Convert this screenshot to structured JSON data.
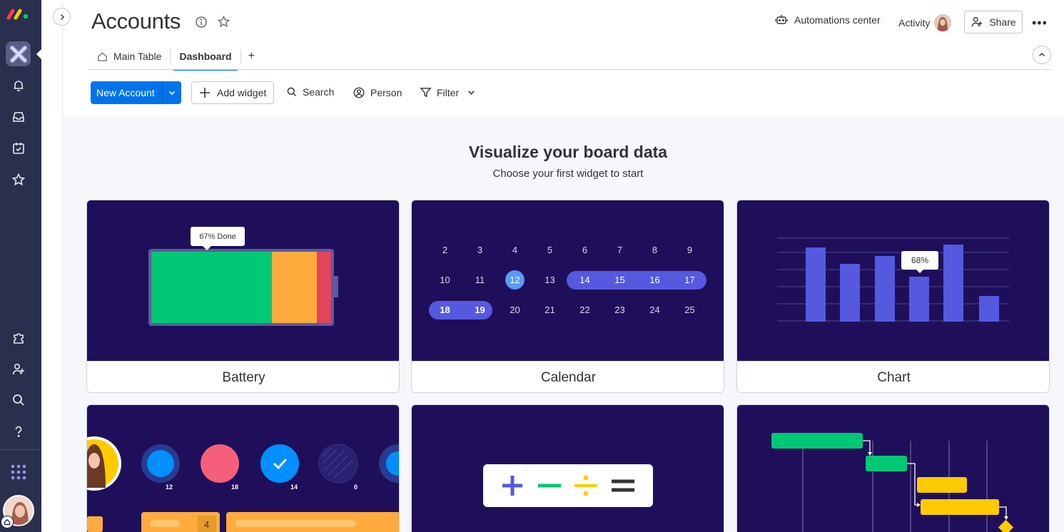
{
  "board": {
    "title": "Accounts"
  },
  "header": {
    "automations_label": "Automations center",
    "activity_label": "Activity",
    "share_label": "Share",
    "more_label": "•••"
  },
  "tabs": [
    {
      "label": "Main Table",
      "active": false
    },
    {
      "label": "Dashboard",
      "active": true
    }
  ],
  "tabs_add_label": "+",
  "toolbar": {
    "new_item_label": "New Account",
    "add_widget_label": "Add widget",
    "search_label": "Search",
    "person_label": "Person",
    "filter_label": "Filter"
  },
  "dashboard": {
    "heading": "Visualize your board data",
    "subheading": "Choose your first widget to start"
  },
  "widgets": {
    "battery": {
      "name": "Battery",
      "tooltip": "67% Done",
      "done_percent": 67
    },
    "calendar": {
      "name": "Calendar",
      "rows": [
        [
          "2",
          "3",
          "4",
          "5",
          "6",
          "7",
          "8",
          "9"
        ],
        [
          "10",
          "11",
          "12",
          "13",
          "14",
          "15",
          "16",
          "17"
        ],
        [
          "18",
          "19",
          "20",
          "21",
          "22",
          "23",
          "24",
          "25"
        ]
      ],
      "today": "12"
    },
    "chart": {
      "name": "Chart",
      "tooltip": "68%"
    },
    "people": {
      "counts": [
        "12",
        "18",
        "14",
        "0"
      ],
      "bar_count": "4"
    }
  },
  "colors": {
    "primary": "#0073ea",
    "rail": "#292f4c",
    "widget_bg": "#1f0f5a",
    "green": "#00c875",
    "orange": "#fdab3d",
    "red": "#e2445c",
    "purple": "#5559df",
    "yellow": "#ffcb00"
  }
}
